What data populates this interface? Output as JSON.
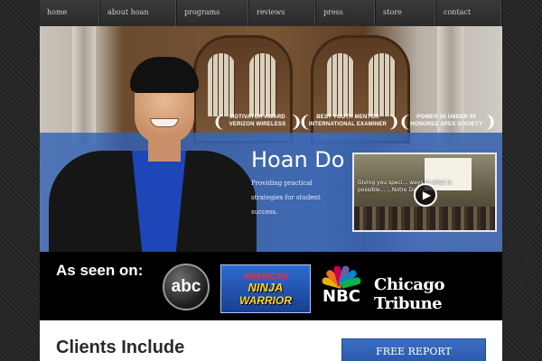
{
  "nav": {
    "items": [
      "home",
      "about hoan",
      "programs",
      "reviews",
      "press",
      "store",
      "contact"
    ]
  },
  "hero": {
    "name": "Hoan Do",
    "tagline": "Providing practical strategies for student success.",
    "awards": [
      {
        "line1": "MOTIVATOR AWARD",
        "line2": "VERIZON WIRELESS"
      },
      {
        "line1": "BEST YOUTH MENTOR",
        "line2": "INTERNATIONAL EXAMINER"
      },
      {
        "line1": "POWER 30 UNDER 30",
        "line2": "HONOREE APEX SOCIETY"
      }
    ],
    "video": {
      "caption": "Giving you speci... ways to what is possible... ...Notre Dame"
    }
  },
  "seen_on": {
    "label": "As seen on:",
    "logos": {
      "abc": "abc",
      "ninja_line1": "AMERICAN",
      "ninja_line2": "NINJA",
      "ninja_line3": "WARRIOR",
      "nbc": "NBC",
      "tribune": "Chicago Tribune"
    }
  },
  "bottom": {
    "clients_heading": "Clients Include",
    "report_button": "FREE REPORT"
  },
  "colors": {
    "nav_bg": "#2e2e2e",
    "hero_blue": "#3a6ec6",
    "button_blue": "#2b59a8",
    "seen_bg": "#000000"
  }
}
